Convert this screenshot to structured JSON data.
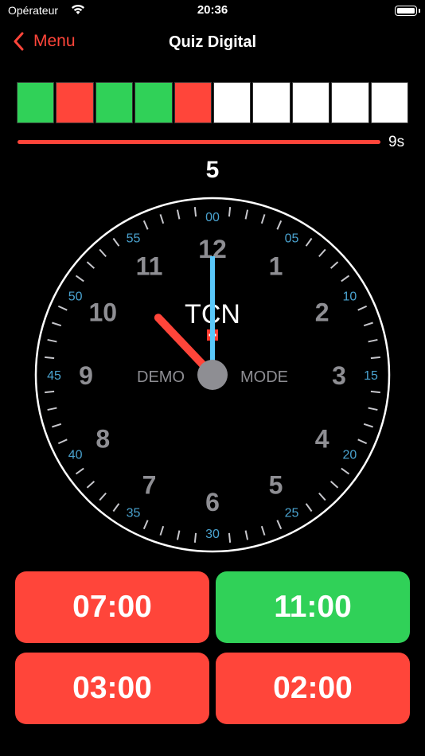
{
  "status_bar": {
    "carrier": "Opérateur",
    "time": "20:36"
  },
  "nav": {
    "back_label": "Menu",
    "title": "Quiz Digital"
  },
  "progress": {
    "results": [
      "correct",
      "wrong",
      "correct",
      "correct",
      "wrong",
      "pending",
      "pending",
      "pending",
      "pending",
      "pending"
    ],
    "colors": {
      "correct": "#30d158",
      "wrong": "#ff453a",
      "pending": "#ffffff"
    }
  },
  "timer": {
    "label": "9s",
    "fraction": 0.95
  },
  "counter": "5",
  "clock": {
    "hours": [
      "12",
      "1",
      "2",
      "3",
      "4",
      "5",
      "6",
      "7",
      "8",
      "9",
      "10",
      "11"
    ],
    "minutes": [
      "00",
      "05",
      "10",
      "15",
      "20",
      "25",
      "30",
      "35",
      "40",
      "45",
      "50",
      "55"
    ],
    "brand": "TCN",
    "left_text": "DEMO",
    "right_text": "MODE",
    "hour_hand_hours": 10.55,
    "minute_hand_minutes": 0,
    "colors": {
      "hour_hand": "#ff453a",
      "minute_hand": "#5ac8fa",
      "minute_labels": "#4aa3d0",
      "hour_labels": "#8e8e93"
    }
  },
  "answers": [
    {
      "label": "07:00",
      "color": "#ff453a"
    },
    {
      "label": "11:00",
      "color": "#30d158"
    },
    {
      "label": "03:00",
      "color": "#ff453a"
    },
    {
      "label": "02:00",
      "color": "#ff453a"
    }
  ]
}
